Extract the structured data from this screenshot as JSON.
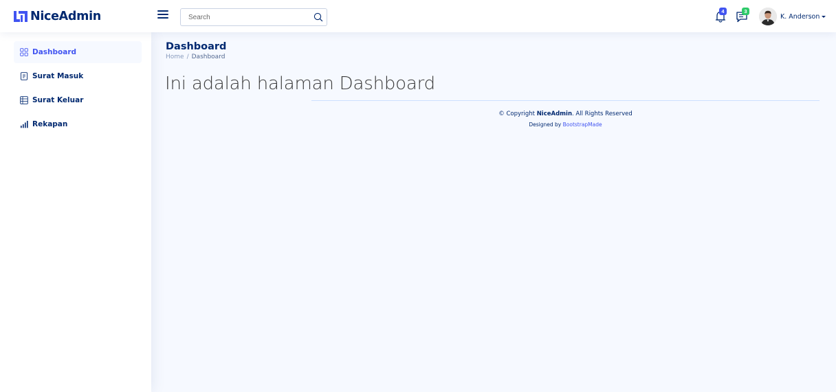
{
  "brand": {
    "name": "NiceAdmin",
    "accent": "#4154f1",
    "dark": "#012970"
  },
  "header": {
    "search": {
      "placeholder": "Search",
      "value": ""
    },
    "notifications": {
      "icon": "bell-icon",
      "count": "4",
      "badge_color": "#4154f1"
    },
    "messages": {
      "icon": "chat-icon",
      "count": "3",
      "badge_color": "#2eca6a"
    },
    "profile": {
      "name": "K. Anderson"
    }
  },
  "sidebar": {
    "items": [
      {
        "label": "Dashboard",
        "icon": "grid-icon",
        "active": true
      },
      {
        "label": "Surat Masuk",
        "icon": "document-icon",
        "active": false
      },
      {
        "label": "Surat Keluar",
        "icon": "table-icon",
        "active": false
      },
      {
        "label": "Rekapan",
        "icon": "bar-chart-icon",
        "active": false
      }
    ]
  },
  "page": {
    "title": "Dashboard",
    "breadcrumb": {
      "home": "Home",
      "separator": "/",
      "current": "Dashboard"
    },
    "heading": "Ini adalah halaman Dashboard"
  },
  "footer": {
    "copyright_prefix": "© Copyright ",
    "copyright_brand": "NiceAdmin",
    "copyright_suffix": ". All Rights Reserved",
    "designed_by_prefix": "Designed by ",
    "designed_by_link": "BootstrapMade"
  }
}
